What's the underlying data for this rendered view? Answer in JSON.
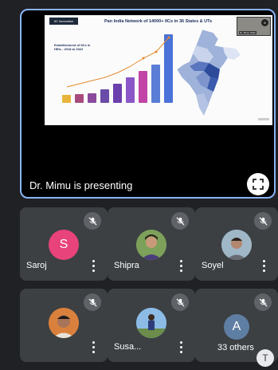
{
  "presentation": {
    "slide_title": "Pan India Network of 14000+ IICs in 36 States & UTs",
    "slide_subtitle": "Establishment of IICs in HEIs - 2018 to 2022",
    "logo_text": "IIC innovation",
    "camera_name": "Dr. Mimu Shah",
    "camera_badge": "8",
    "status": "Dr. Mimu is presenting"
  },
  "participants": [
    {
      "name": "Saroj",
      "initial": "S",
      "color": "#e8437b",
      "muted": true
    },
    {
      "name": "Shipra",
      "muted": true
    },
    {
      "name": "Soyel",
      "muted": true
    },
    {
      "name": "",
      "muted": true
    },
    {
      "name": "Susa...",
      "muted": true
    },
    {
      "name": "33 others",
      "initial": "A",
      "color": "#5f7ea3",
      "muted": true
    }
  ],
  "controls": {
    "caption_label": "T"
  }
}
